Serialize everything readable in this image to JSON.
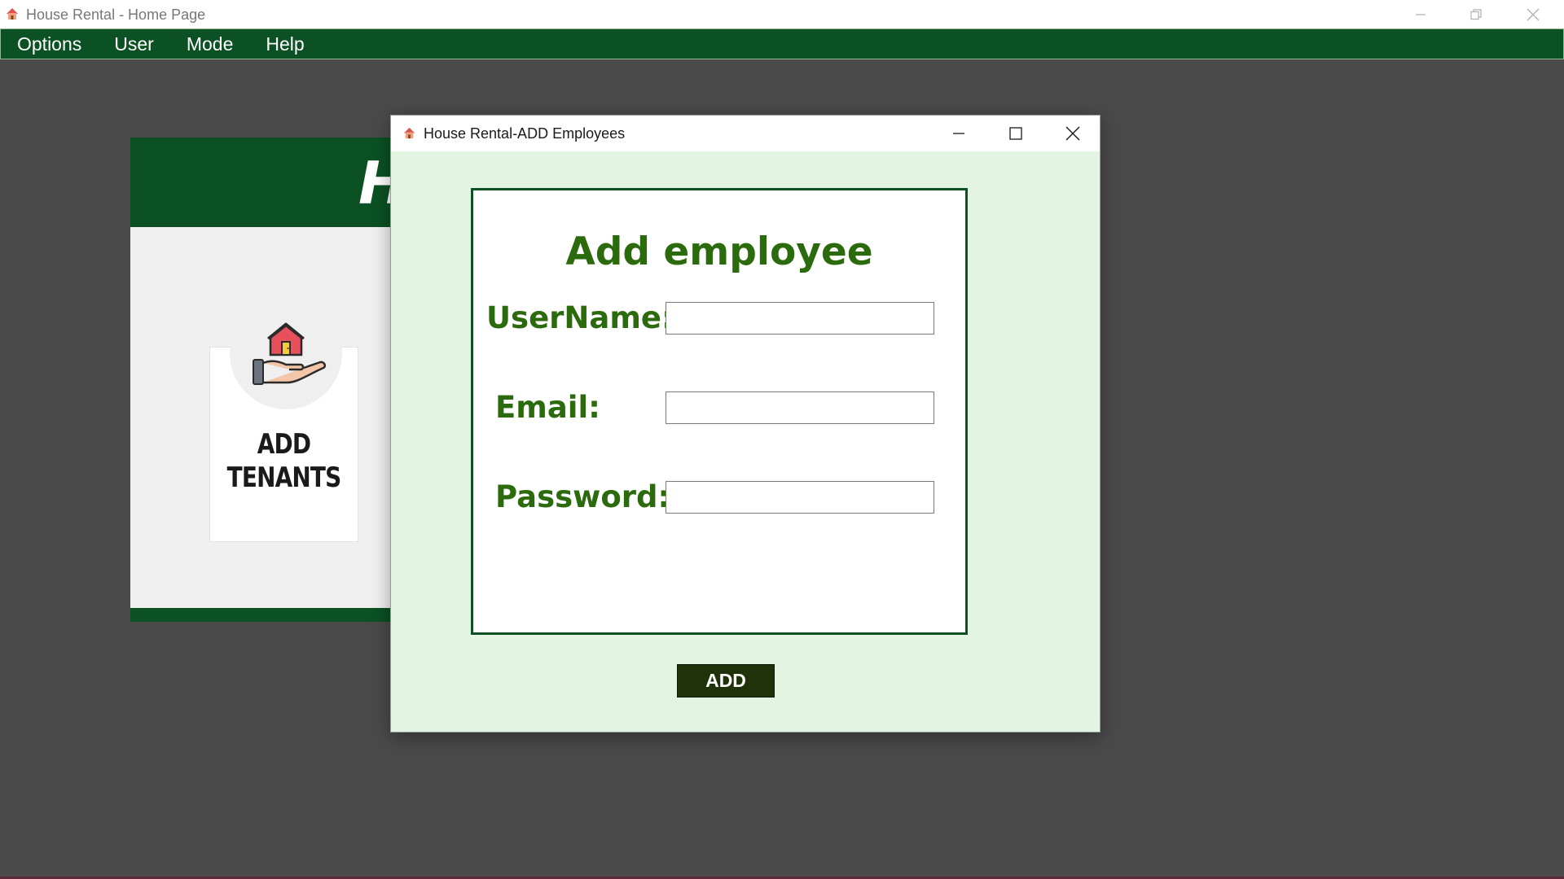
{
  "main_window": {
    "title": "House Rental - Home Page",
    "icon": "house-icon"
  },
  "menubar": {
    "items": [
      {
        "label": "Options"
      },
      {
        "label": "User"
      },
      {
        "label": "Mode"
      },
      {
        "label": "Help"
      }
    ]
  },
  "home": {
    "header_title": "H",
    "card": {
      "label_line1": "ADD",
      "label_line2": "TENANTS",
      "icon": "house-in-hand-icon"
    }
  },
  "dialog": {
    "title": "House Rental-ADD Employees",
    "icon": "house-icon",
    "form_title": "Add employee",
    "fields": {
      "username": {
        "label": "UserName:",
        "value": ""
      },
      "email": {
        "label": "Email:",
        "value": ""
      },
      "password": {
        "label": "Password:",
        "value": ""
      }
    },
    "add_button_label": "ADD"
  },
  "colors": {
    "brand_green": "#0b5123",
    "label_green": "#2b6b0e",
    "dialog_bg": "#e4f4e2",
    "button_dark": "#1f3209",
    "desktop_bg": "#4a4a4a"
  }
}
